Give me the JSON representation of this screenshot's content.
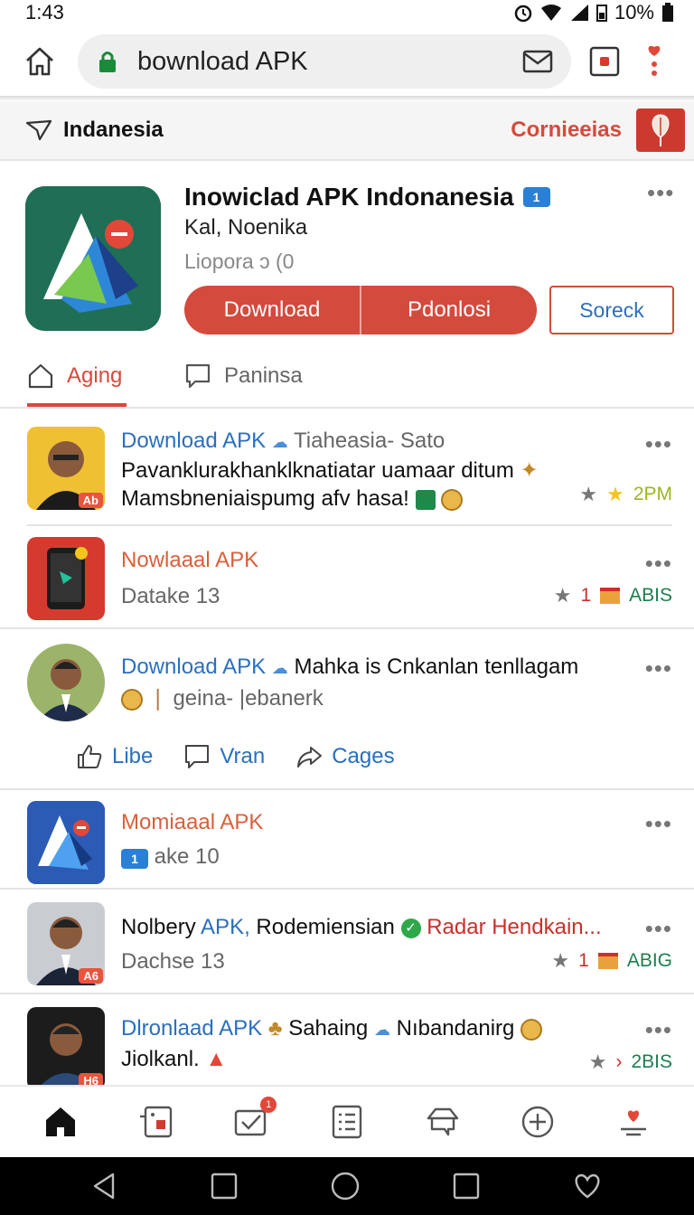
{
  "status_bar": {
    "time": "1:43",
    "battery": "10%"
  },
  "browser": {
    "url": "bownload APK"
  },
  "region": {
    "location": "Indanesia",
    "action": "Cornieeias"
  },
  "app": {
    "title": "Inowiclad APK Indonanesia",
    "verified": "1",
    "developer": "Kal, Noenika",
    "version": "Liopora ɔ (0",
    "download_label": "Download",
    "secondary_label": "Pdonlosi",
    "outline_label": "Soreck",
    "tab_active": "Aging",
    "tab_inactive": "Paninsa"
  },
  "feed": [
    {
      "author": "Download APK",
      "tag": "Tiaheasia- Sato",
      "line1": "Pavanklurakhanklknatiatar uamaar ditum",
      "line2": "Mamsbneniaispumg afv hasa!",
      "meta": "2PM",
      "avatar_badge": "Ab"
    },
    {
      "title": "Nowlaaal APK",
      "subtitle": "Datake 13",
      "meta_count": "1",
      "meta": "ABIS"
    },
    {
      "author": "Download APK",
      "tag": "Mahka is Cnkanlan tenllagam",
      "line2": "geina- |ebanerk",
      "actions": [
        "Libe",
        "Vran",
        "Cages"
      ]
    },
    {
      "title": "Momiaaal APK",
      "subtitle": "ake 10",
      "subtitle_badge": "1"
    },
    {
      "author_a": "Nolbery",
      "author_b": "APK,",
      "text": "Rodemiensian",
      "tag": "Radar Hendkain...",
      "subtitle": "Dachse 13",
      "meta_count": "1",
      "meta": "ABIG",
      "avatar_badge": "A6"
    },
    {
      "author": "Dlronlaad APK",
      "text_a": "Sahaing",
      "text_b": "Nıbandanirg",
      "line2": "Jiolkanl.",
      "meta": "2BIS",
      "avatar_badge": "H6"
    }
  ],
  "bottom_nav": {
    "notif_count": "1"
  },
  "colors": {
    "accent": "#d44a3c",
    "link": "#2a6fbf",
    "app_icon_bg": "#1f6e56"
  }
}
